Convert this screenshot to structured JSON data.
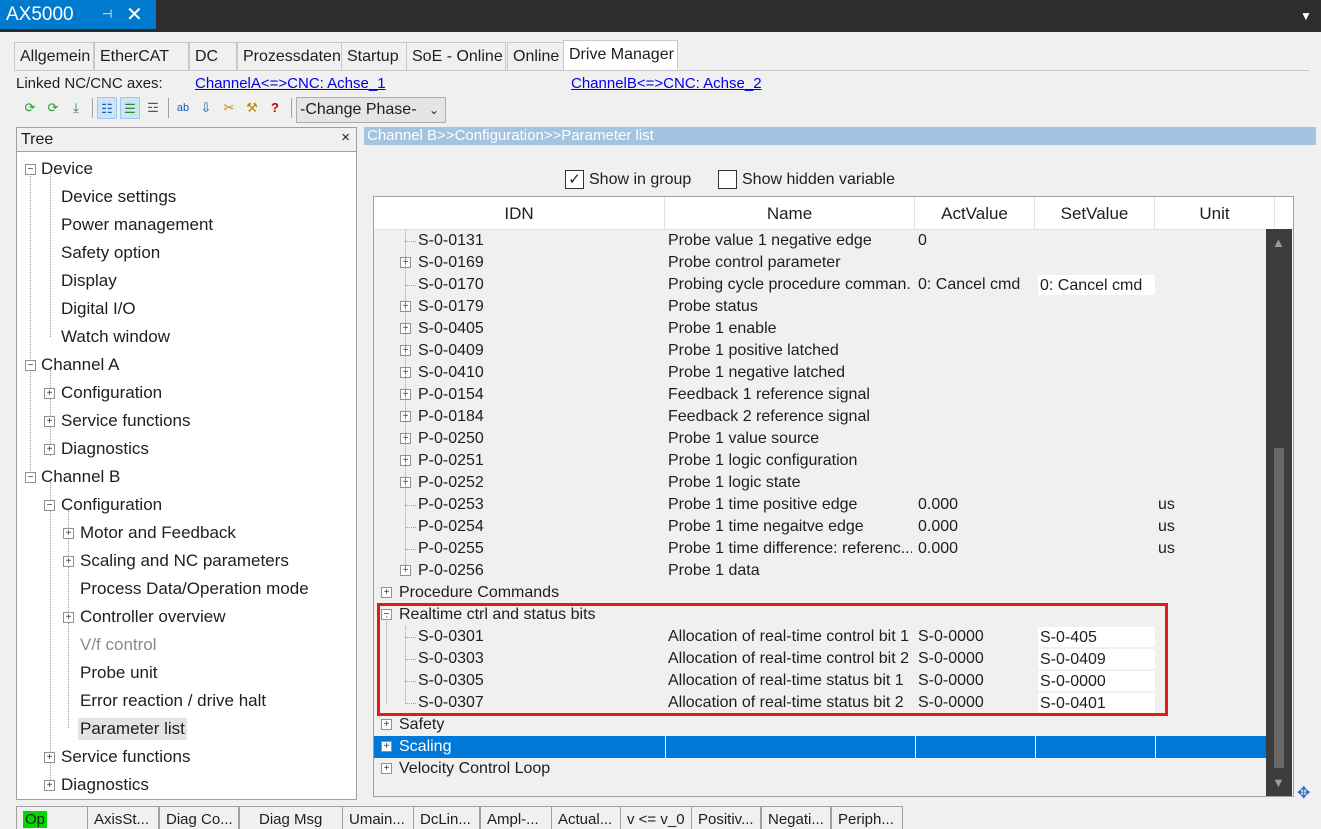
{
  "doc_tab": {
    "title": "AX5000",
    "pin": "⊣",
    "close": "✕",
    "dropdown": "▼"
  },
  "tabs": [
    "Allgemein",
    "EtherCAT",
    "DC",
    "Prozessdaten",
    "Startup",
    "SoE - Online",
    "Online",
    "Drive Manager"
  ],
  "active_tab": "Drive Manager",
  "linked": {
    "label": "Linked NC/CNC axes:",
    "channel_a": "ChannelA<=>CNC: Achse_1",
    "channel_b": "ChannelB<=>CNC: Achse_2"
  },
  "toolbar": {
    "icons": [
      "refresh-green-icon",
      "refresh-all-icon",
      "download-icon",
      "tree-view-icon",
      "list-view-icon",
      "compare-icon",
      "abc-icon",
      "sort-down-icon",
      "tool-icon",
      "wrench-icon",
      "help-icon"
    ],
    "glyphs": [
      "⟳",
      "⟳",
      "⤓",
      "☷",
      "☰",
      "☲",
      "ab",
      "⇩",
      "✂",
      "⚒",
      "?"
    ],
    "phase_label": "-Change Phase-",
    "phase_chevron": "⌄"
  },
  "tree": {
    "header": "Tree",
    "close": "×",
    "items": [
      "Device",
      "Device settings",
      "Power management",
      "Safety option",
      "Display",
      "Digital I/O",
      "Watch window",
      "Channel A",
      "Configuration",
      "Service functions",
      "Diagnostics",
      "Channel B",
      "Configuration",
      "Motor and Feedback",
      "Scaling and NC parameters",
      "Process Data/Operation mode",
      "Controller overview",
      "V/f control",
      "Probe unit",
      "Error reaction / drive halt",
      "Parameter list",
      "Service functions",
      "Diagnostics"
    ]
  },
  "breadcrumb": "Channel B>>Configuration>>Parameter list",
  "options": {
    "show_in_group": "Show in group",
    "show_in_group_mark": "✓",
    "show_hidden": "Show hidden variable"
  },
  "grid": {
    "columns": [
      "IDN",
      "Name",
      "ActValue",
      "SetValue",
      "Unit"
    ],
    "rows": [
      {
        "idn": "S-0-0131",
        "name": "Probe value 1 negative edge",
        "act": "0",
        "set": "",
        "unit": ""
      },
      {
        "idn": "S-0-0169",
        "name": "Probe control parameter",
        "act": "",
        "set": "",
        "unit": ""
      },
      {
        "idn": "S-0-0170",
        "name": "Probing cycle procedure comman...",
        "act": "0: Cancel cmd",
        "set": "0: Cancel cmd",
        "unit": ""
      },
      {
        "idn": "S-0-0179",
        "name": "Probe status",
        "act": "",
        "set": "",
        "unit": ""
      },
      {
        "idn": "S-0-0405",
        "name": "Probe 1 enable",
        "act": "",
        "set": "",
        "unit": ""
      },
      {
        "idn": "S-0-0409",
        "name": "Probe 1 positive latched",
        "act": "",
        "set": "",
        "unit": ""
      },
      {
        "idn": "S-0-0410",
        "name": "Probe 1 negative latched",
        "act": "",
        "set": "",
        "unit": ""
      },
      {
        "idn": "P-0-0154",
        "name": "Feedback 1 reference signal",
        "act": "",
        "set": "",
        "unit": ""
      },
      {
        "idn": "P-0-0184",
        "name": "Feedback 2 reference signal",
        "act": "",
        "set": "",
        "unit": ""
      },
      {
        "idn": "P-0-0250",
        "name": "Probe 1 value source",
        "act": "",
        "set": "",
        "unit": ""
      },
      {
        "idn": "P-0-0251",
        "name": "Probe 1 logic configuration",
        "act": "",
        "set": "",
        "unit": ""
      },
      {
        "idn": "P-0-0252",
        "name": "Probe 1 logic state",
        "act": "",
        "set": "",
        "unit": ""
      },
      {
        "idn": "P-0-0253",
        "name": "Probe 1 time positive edge",
        "act": "0.000",
        "set": "",
        "unit": "us"
      },
      {
        "idn": "P-0-0254",
        "name": "Probe 1 time negaitve edge",
        "act": "0.000",
        "set": "",
        "unit": "us"
      },
      {
        "idn": "P-0-0255",
        "name": "Probe 1 time difference: referenc...",
        "act": "0.000",
        "set": "",
        "unit": "us"
      },
      {
        "idn": "P-0-0256",
        "name": "Probe 1 data",
        "act": "",
        "set": "",
        "unit": ""
      },
      {
        "idn": "Procedure Commands",
        "name": "",
        "act": "",
        "set": "",
        "unit": ""
      },
      {
        "idn": "Realtime ctrl and status bits",
        "name": "",
        "act": "",
        "set": "",
        "unit": ""
      },
      {
        "idn": "S-0-0301",
        "name": "Allocation of real-time control bit 1",
        "act": "S-0-0000",
        "set": "S-0-405",
        "unit": ""
      },
      {
        "idn": "S-0-0303",
        "name": "Allocation of real-time control bit 2",
        "act": "S-0-0000",
        "set": "S-0-0409",
        "unit": ""
      },
      {
        "idn": "S-0-0305",
        "name": "Allocation of real-time status bit 1",
        "act": "S-0-0000",
        "set": "S-0-0000",
        "unit": ""
      },
      {
        "idn": "S-0-0307",
        "name": "Allocation of real-time status bit 2",
        "act": "S-0-0000",
        "set": "S-0-0401",
        "unit": ""
      },
      {
        "idn": "Safety",
        "name": "",
        "act": "",
        "set": "",
        "unit": ""
      },
      {
        "idn": "Scaling",
        "name": "",
        "act": "",
        "set": "",
        "unit": ""
      },
      {
        "idn": "Velocity Control Loop",
        "name": "",
        "act": "",
        "set": "",
        "unit": ""
      }
    ]
  },
  "scroll": {
    "up": "▲",
    "down": "▼"
  },
  "pin_icon": "✥",
  "statusbar": [
    "Op",
    "AxisSt...",
    "Diag Co...",
    "Diag Msg",
    "Umain...",
    "DcLin...",
    "Ampl-...",
    "Actual...",
    "v <= v_0",
    "Positiv...",
    "Negati...",
    "Periph..."
  ],
  "colors": {
    "accent": "#007acc",
    "selection": "#0078d7",
    "highlight": "#e31a1a",
    "op_status": "#00d800"
  }
}
